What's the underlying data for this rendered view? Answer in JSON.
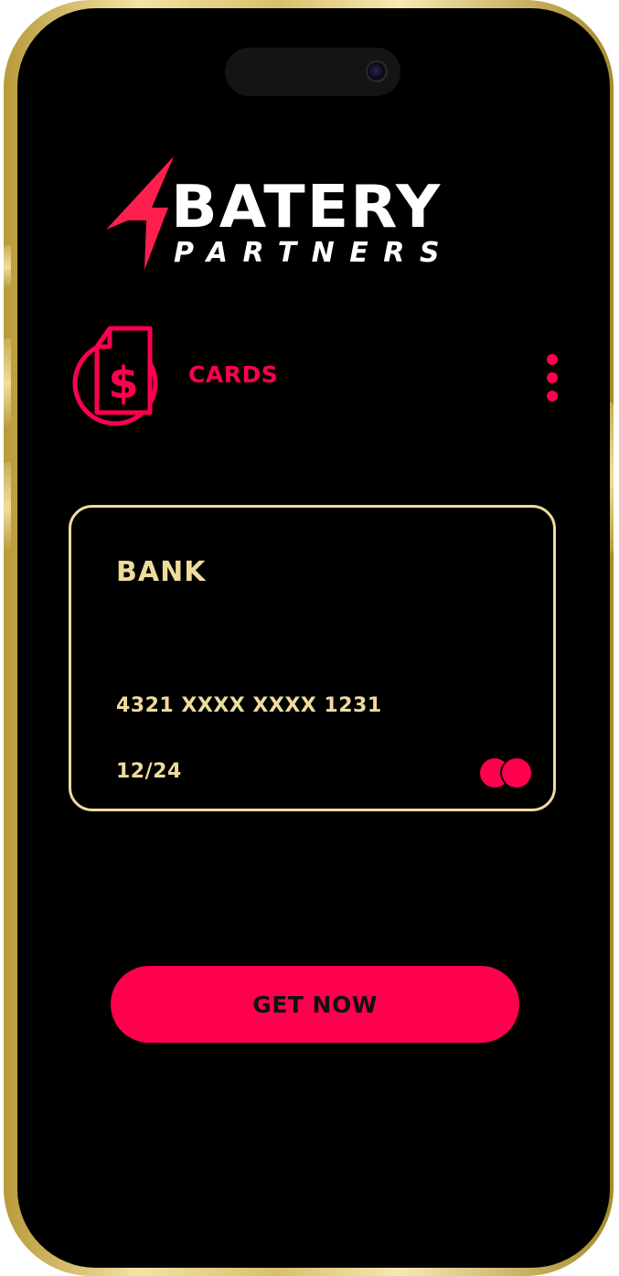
{
  "brand": {
    "name": "BATERY",
    "subtitle": "PARTNERS"
  },
  "section": {
    "icon": "dollar-document-icon",
    "title": "CARDS",
    "menu_icon": "more-vertical-icon"
  },
  "card": {
    "bank": "BANK",
    "number": "4321 XXXX XXXX 1231",
    "expiry": "12/24",
    "network_icon": "card-network-icon"
  },
  "cta": {
    "label": "GET NOW"
  },
  "colors": {
    "accent": "#ff004e",
    "card_gold": "#efdb9c",
    "background": "#000000",
    "frame_gold": "#d8bf6b"
  }
}
